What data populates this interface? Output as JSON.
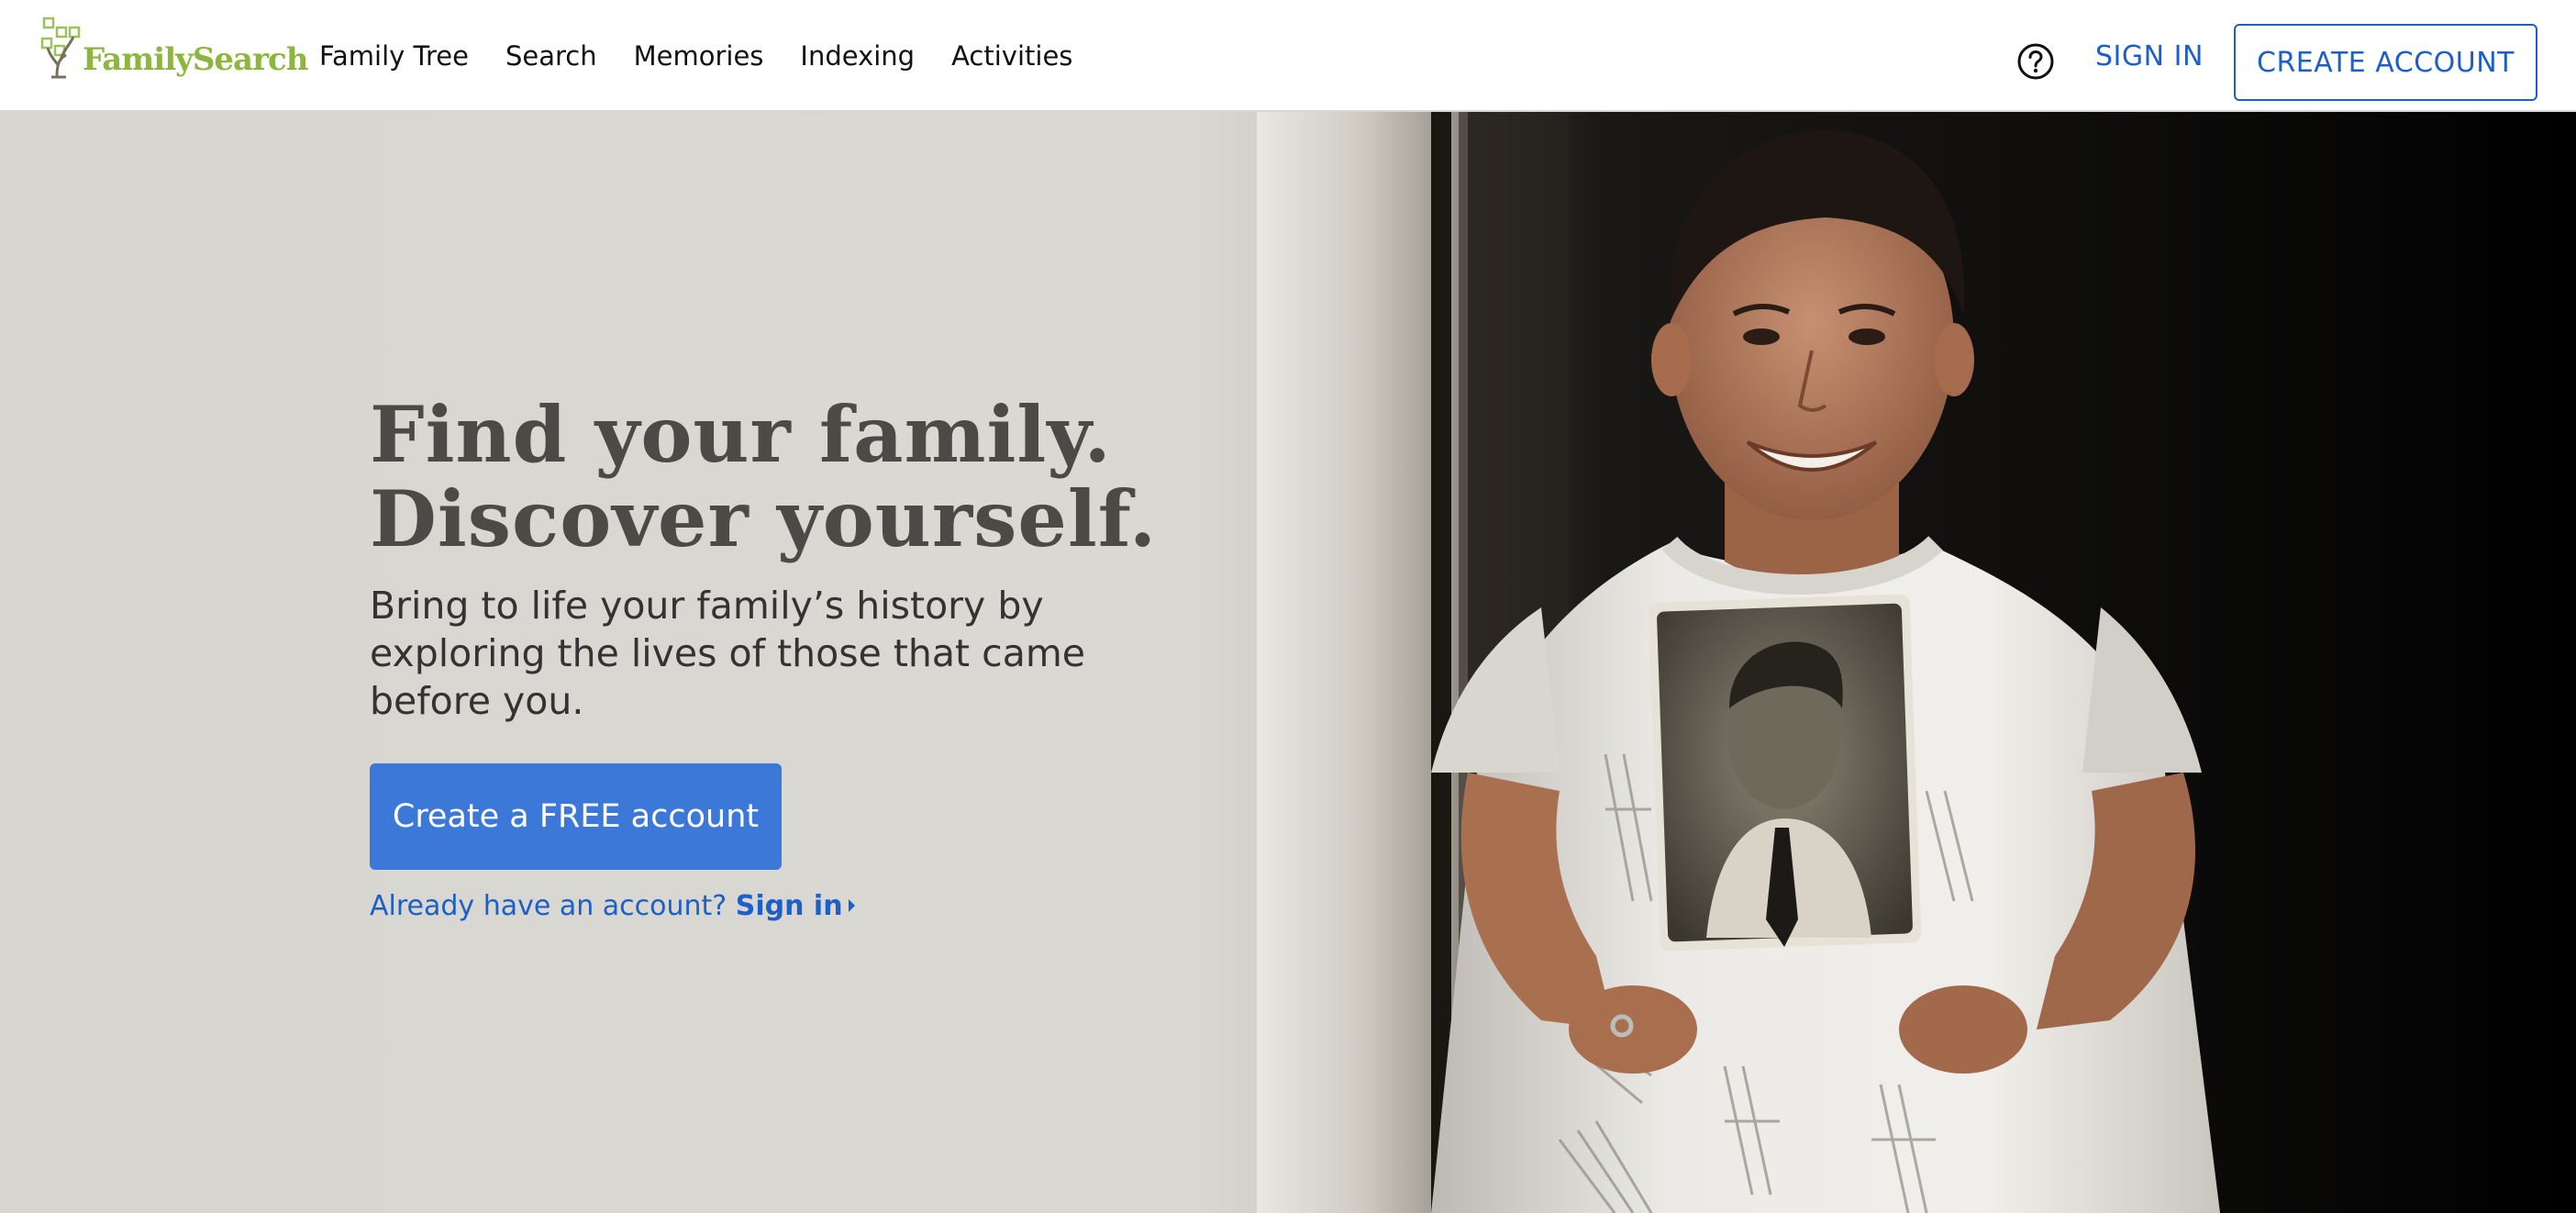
{
  "brand": {
    "name": "FamilySearch",
    "color": "#8cb63c"
  },
  "nav": {
    "items": [
      "Family Tree",
      "Search",
      "Memories",
      "Indexing",
      "Activities"
    ]
  },
  "header": {
    "help_icon": "question-circle-icon",
    "sign_in": "SIGN IN",
    "create_account": "CREATE ACCOUNT"
  },
  "hero": {
    "title_line1": "Find your family.",
    "title_line2": "Discover yourself.",
    "subtitle": "Bring to life your family’s history by exploring the lives of those that came before you.",
    "cta": "Create a FREE account",
    "already_text": "Already have an account?",
    "sign_in_link": "Sign in",
    "photo": "boy-holding-vintage-portrait-photo"
  },
  "colors": {
    "link": "#1d5fc9",
    "cta_bg": "#3c78d8",
    "title": "#4c4a46"
  }
}
